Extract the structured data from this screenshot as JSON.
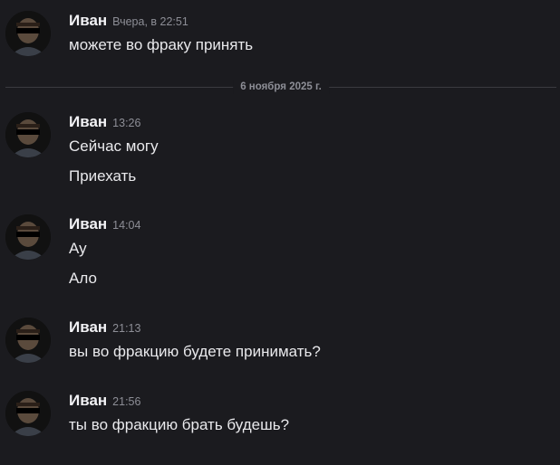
{
  "messages": [
    {
      "author": "Иван",
      "time": "Вчера, в 22:51",
      "lines": [
        "можете во фраку принять"
      ]
    },
    {
      "author": "Иван",
      "time": "13:26",
      "lines": [
        "Сейчас могу",
        "Приехать"
      ]
    },
    {
      "author": "Иван",
      "time": "14:04",
      "lines": [
        "Ау",
        "Ало"
      ]
    },
    {
      "author": "Иван",
      "time": "21:13",
      "lines": [
        "вы во фракцию будете принимать?"
      ]
    },
    {
      "author": "Иван",
      "time": "21:56",
      "lines": [
        "ты во фракцию брать будешь?"
      ]
    }
  ],
  "date_divider": "6 ноября 2025 г."
}
